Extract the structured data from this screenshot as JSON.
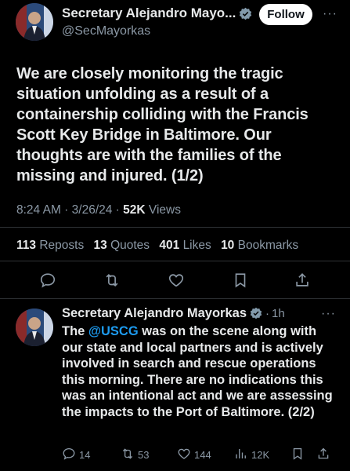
{
  "tweet": {
    "author_name": "Secretary Alejandro Mayo...",
    "handle": "@SecMayorkas",
    "follow_label": "Follow",
    "more_label": "···",
    "text": "We are closely monitoring the tragic situation unfolding as a result of a containership colliding with the Francis Scott Key Bridge in Baltimore. Our thoughts are with the families of the missing and injured. (1/2)",
    "time": "8:24 AM",
    "date": "3/26/24",
    "views": "52K",
    "views_label": "Views",
    "reposts": "113",
    "reposts_label": "Reposts",
    "quotes": "13",
    "quotes_label": "Quotes",
    "likes": "401",
    "likes_label": "Likes",
    "bookmarks": "10",
    "bookmarks_label": "Bookmarks"
  },
  "reply": {
    "author_name": "Secretary Alejandro Mayorkas",
    "time": "1h",
    "more_label": "···",
    "mention": "@USCG",
    "text_before": "The ",
    "text_after": " was on the scene along with our state and local partners and is actively involved in search and rescue operations this morning. There are no indications this was an intentional act and we are assessing the impacts to the Port of Baltimore. (2/2)",
    "replies": "14",
    "reposts": "53",
    "likes": "144",
    "views": "12K"
  },
  "colors": {
    "background": "#000000",
    "text": "#e7e9ea",
    "secondary": "#8b98a5",
    "accent": "#1d9bf0",
    "verified_gold": "#829aab"
  },
  "icons": [
    "verified-icon",
    "reply-icon",
    "repost-icon",
    "like-icon",
    "bookmark-icon",
    "share-icon",
    "views-icon"
  ]
}
